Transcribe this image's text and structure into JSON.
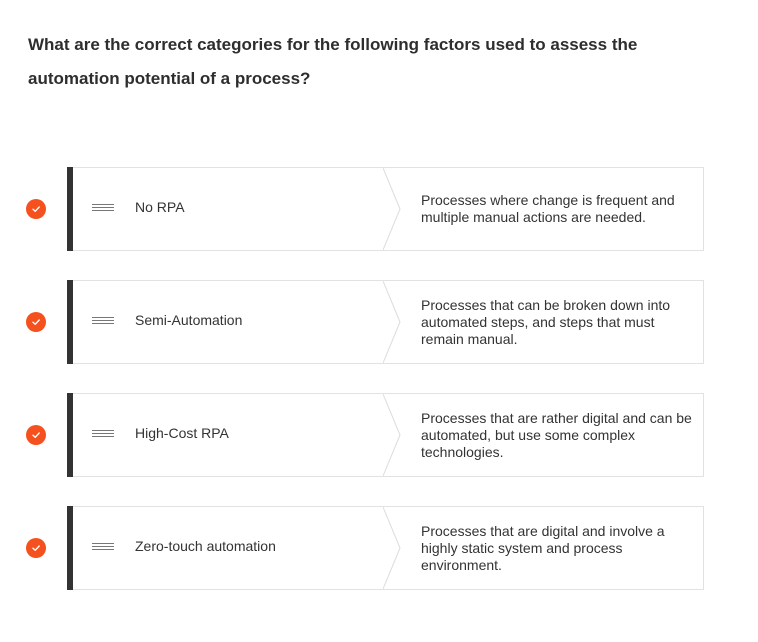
{
  "question": {
    "text": "What are the correct categories for the following factors used to assess the automation potential of a process?"
  },
  "items": [
    {
      "category": "No RPA",
      "description": "Processes where change is frequent and multiple manual actions are needed.",
      "status_icon": "checkmark-icon"
    },
    {
      "category": "Semi-Automation",
      "description": "Processes that can be broken down into automated steps, and steps that must remain manual.",
      "status_icon": "checkmark-icon"
    },
    {
      "category": "High-Cost RPA",
      "description": "Processes that are rather digital and can be automated, but use some complex technologies.",
      "status_icon": "checkmark-icon"
    },
    {
      "category": "Zero-touch automation",
      "description": "Processes that are digital and involve a highly static system and process environment.",
      "status_icon": "checkmark-icon"
    }
  ],
  "colors": {
    "accent": "#f4511e",
    "bar": "#333333",
    "border": "#e2e2e2"
  }
}
